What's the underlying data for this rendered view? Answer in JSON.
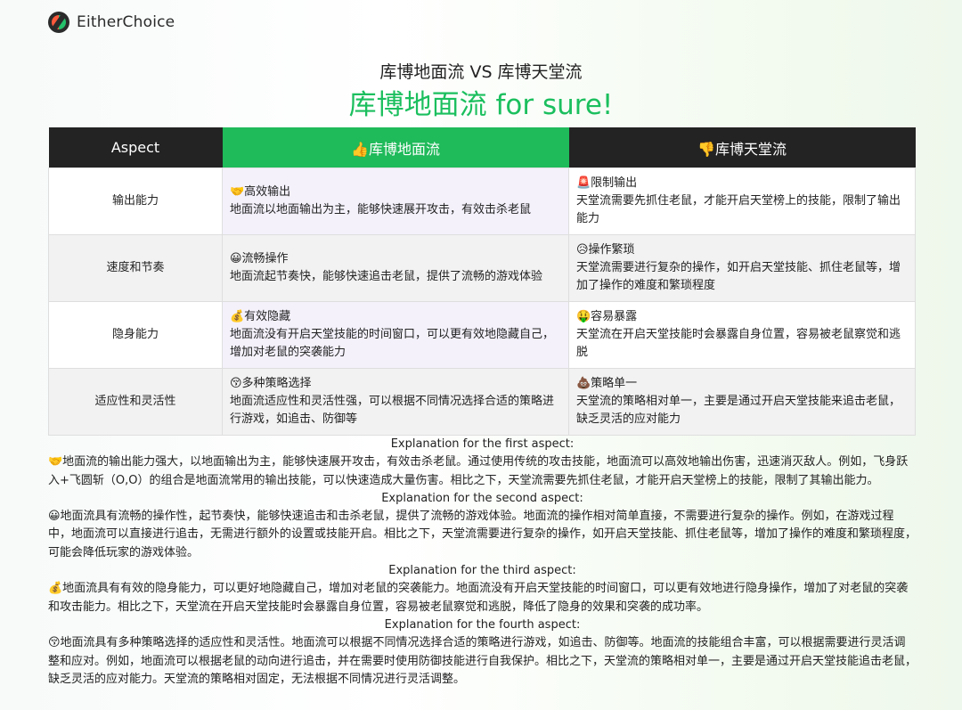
{
  "brand": {
    "name": "EitherChoice",
    "logo_icon": "either-choice-logo"
  },
  "headline": "库博地面流 VS 库博天堂流",
  "verdict": "库博地面流 for sure!",
  "colors": {
    "accent_green": "#1fba5a",
    "header_dark": "#232323"
  },
  "table": {
    "headers": {
      "aspect": "Aspect",
      "option_a": "👍库博地面流",
      "option_b": "👎库博天堂流"
    },
    "rows": [
      {
        "aspect": "输出能力",
        "a_title": "🤝高效输出",
        "a_desc": "地面流以地面输出为主，能够快速展开攻击，有效击杀老鼠",
        "b_title": "🚨限制输出",
        "b_desc": "天堂流需要先抓住老鼠，才能开启天堂榜上的技能，限制了输出能力"
      },
      {
        "aspect": "速度和节奏",
        "a_title": "😀流畅操作",
        "a_desc": "地面流起节奏快，能够快速追击老鼠，提供了流畅的游戏体验",
        "b_title": "😥操作繁琐",
        "b_desc": "天堂流需要进行复杂的操作，如开启天堂技能、抓住老鼠等，增加了操作的难度和繁琐程度"
      },
      {
        "aspect": "隐身能力",
        "a_title": "💰有效隐藏",
        "a_desc": "地面流没有开启天堂技能的时间窗口，可以更有效地隐藏自己，增加对老鼠的突袭能力",
        "b_title": "🤑容易暴露",
        "b_desc": "天堂流在开启天堂技能时会暴露自身位置，容易被老鼠察觉和逃脱"
      },
      {
        "aspect": "适应性和灵活性",
        "a_title": "😚多种策略选择",
        "a_desc": "地面流适应性和灵活性强，可以根据不同情况选择合适的策略进行游戏，如追击、防御等",
        "b_title": "💩策略单一",
        "b_desc": "天堂流的策略相对单一，主要是通过开启天堂技能来追击老鼠，缺乏灵活的应对能力"
      }
    ]
  },
  "explanations": [
    {
      "heading": "Explanation for the first aspect:",
      "body": "🤝地面流的输出能力强大，以地面输出为主，能够快速展开攻击，有效击杀老鼠。通过使用传统的攻击技能，地面流可以高效地输出伤害，迅速消灭敌人。例如，飞身跃入+飞圆斩（O,O）的组合是地面流常用的输出技能，可以快速造成大量伤害。相比之下，天堂流需要先抓住老鼠，才能开启天堂榜上的技能，限制了其输出能力。"
    },
    {
      "heading": "Explanation for the second aspect:",
      "body": "😀地面流具有流畅的操作性，起节奏快，能够快速追击和击杀老鼠，提供了流畅的游戏体验。地面流的操作相对简单直接，不需要进行复杂的操作。例如，在游戏过程中，地面流可以直接进行追击，无需进行额外的设置或技能开启。相比之下，天堂流需要进行复杂的操作，如开启天堂技能、抓住老鼠等，增加了操作的难度和繁琐程度，可能会降低玩家的游戏体验。"
    },
    {
      "heading": "Explanation for the third aspect:",
      "body": "💰地面流具有有效的隐身能力，可以更好地隐藏自己，增加对老鼠的突袭能力。地面流没有开启天堂技能的时间窗口，可以更有效地进行隐身操作，增加了对老鼠的突袭和攻击能力。相比之下，天堂流在开启天堂技能时会暴露自身位置，容易被老鼠察觉和逃脱，降低了隐身的效果和突袭的成功率。"
    },
    {
      "heading": "Explanation for the fourth aspect:",
      "body": "😚地面流具有多种策略选择的适应性和灵活性。地面流可以根据不同情况选择合适的策略进行游戏，如追击、防御等。地面流的技能组合丰富，可以根据需要进行灵活调整和应对。例如，地面流可以根据老鼠的动向进行追击，并在需要时使用防御技能进行自我保护。相比之下，天堂流的策略相对单一，主要是通过开启天堂技能追击老鼠，缺乏灵活的应对能力。天堂流的策略相对固定，无法根据不同情况进行灵活调整。"
    }
  ]
}
